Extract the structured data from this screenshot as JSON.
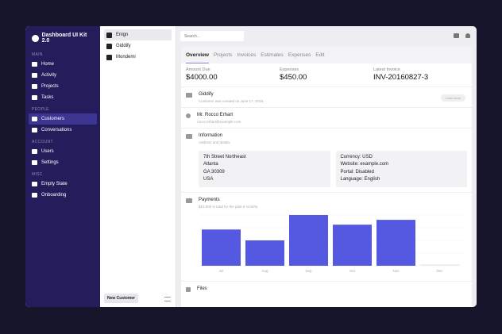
{
  "sidebar": {
    "brand": "Dashboard UI Kit 2.0",
    "sections": [
      {
        "title": "MAIN",
        "items": [
          {
            "label": "Home",
            "icon": "home-icon"
          },
          {
            "label": "Activity",
            "icon": "activity-icon"
          },
          {
            "label": "Projects",
            "icon": "folder-icon"
          },
          {
            "label": "Tasks",
            "icon": "tasks-icon"
          }
        ]
      },
      {
        "title": "PEOPLE",
        "items": [
          {
            "label": "Customers",
            "icon": "customers-icon",
            "active": true
          },
          {
            "label": "Conversations",
            "icon": "chat-icon"
          }
        ]
      },
      {
        "title": "ACCOUNT",
        "items": [
          {
            "label": "Users",
            "icon": "user-icon"
          },
          {
            "label": "Settings",
            "icon": "gear-icon"
          }
        ]
      },
      {
        "title": "MISC",
        "items": [
          {
            "label": "Empty State",
            "icon": "pin-icon"
          },
          {
            "label": "Onboarding",
            "icon": "lock-icon"
          }
        ]
      }
    ]
  },
  "customers": {
    "items": [
      "Enign",
      "Giddify",
      "Mondemi"
    ],
    "selected": "Enign",
    "new_button": "New Customer"
  },
  "search": {
    "placeholder": "Search..."
  },
  "tabs": [
    "Overview",
    "Projects",
    "Invoices",
    "Estimates",
    "Expenses",
    "Edit"
  ],
  "stats": [
    {
      "label": "Amount Due",
      "value": "$4000.00"
    },
    {
      "label": "Expenses",
      "value": "$450.00"
    },
    {
      "label": "Latest Invoice",
      "value": "INV-20160827-3"
    }
  ],
  "company": {
    "name": "Giddify",
    "sub": "Customer was created on June 17, 2018.",
    "badge": "Load more"
  },
  "contact": {
    "name": "Mr. Rocco Erhart",
    "email": "rocco.erhart@example.com"
  },
  "information": {
    "title": "Information",
    "sub": "Address and details.",
    "address": [
      "7th Street Northeast",
      "Atlanta",
      "GA 30309",
      "USA"
    ],
    "details": [
      "Currency: USD",
      "Website: example.com",
      "Portal: Disabled",
      "Language: English"
    ]
  },
  "payments": {
    "title": "Payments",
    "sub": "$16,600 in total for the past 6 months."
  },
  "files": {
    "title": "Files"
  },
  "chart_data": {
    "type": "bar",
    "categories": [
      "Jul",
      "Aug",
      "Sep",
      "Oct",
      "Nov",
      "Dec"
    ],
    "values": [
      3000,
      2100,
      4200,
      3400,
      3800,
      100
    ],
    "color": "#5558e0",
    "grid": true
  }
}
